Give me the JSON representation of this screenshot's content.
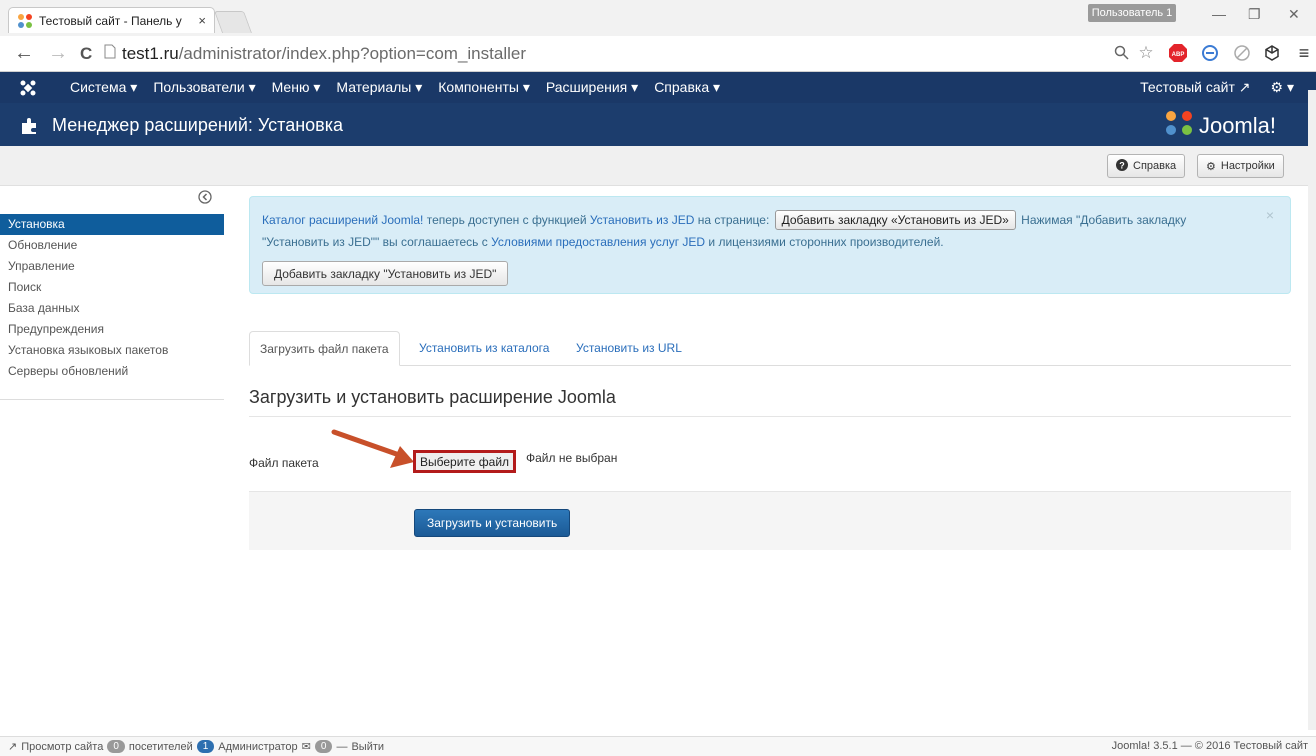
{
  "browser": {
    "tab_title": "Тестовый сайт - Панель у",
    "tab_close": "×",
    "user_badge": "Пользователь 1",
    "url_host": "test1.ru",
    "url_rest": "/administrator/index.php?option=com_installer",
    "back_glyph": "←",
    "forward_glyph": "→",
    "reload_glyph": "C"
  },
  "navbar": {
    "menu": [
      "Система ▾",
      "Пользователи ▾",
      "Меню ▾",
      "Материалы ▾",
      "Компоненты ▾",
      "Расширения ▾",
      "Справка ▾"
    ],
    "site_link": "Тестовый сайт ↗",
    "gear": "⚙ ▾"
  },
  "header": {
    "title": "Менеджер расширений: Установка",
    "brand": "Joomla!"
  },
  "toolbar": {
    "help": "Справка",
    "options": "Настройки"
  },
  "sidebar": {
    "items": [
      "Установка",
      "Обновление",
      "Управление",
      "Поиск",
      "База данных",
      "Предупреждения",
      "Установка языковых пакетов",
      "Серверы обновлений"
    ],
    "active_index": 0
  },
  "alert": {
    "part1": "Каталог расширений Joomla!",
    "part2": " теперь доступен с функцией ",
    "part3": "Установить из JED",
    "part4": " на странице: ",
    "inline_button": "Добавить закладку «Установить из JED»",
    "part5": " Нажимая \"Добавить закладку",
    "line2_a": "\"Установить из JED\"\" вы соглашаетесь с ",
    "line2_link": "Условиями предоставления услуг JED",
    "line2_b": " и лицензиями сторонних производителей.",
    "button": "Добавить закладку \"Установить из JED\"",
    "close": "×"
  },
  "tabs": [
    "Загрузить файл пакета",
    "Установить из каталога",
    "Установить из URL"
  ],
  "form": {
    "legend": "Загрузить и установить расширение Joomla",
    "file_label": "Файл пакета",
    "file_button": "Выберите файл",
    "no_file": "Файл не выбран",
    "submit": "Загрузить и установить"
  },
  "statusbar": {
    "view_site": "Просмотр сайта",
    "visitors_count": "0",
    "visitors_label": "посетителей",
    "admins_count": "1",
    "admins_label": "Администратор",
    "messages_count": "0",
    "logout_prefix": "—",
    "logout": "Выйти",
    "right": "Joomla! 3.5.1 — © 2016 Тестовый сайт"
  },
  "colors": {
    "navbar": "#1a3867",
    "header": "#1c3d6d",
    "active": "#0f5d9c",
    "accent_red": "#b31b1b"
  }
}
